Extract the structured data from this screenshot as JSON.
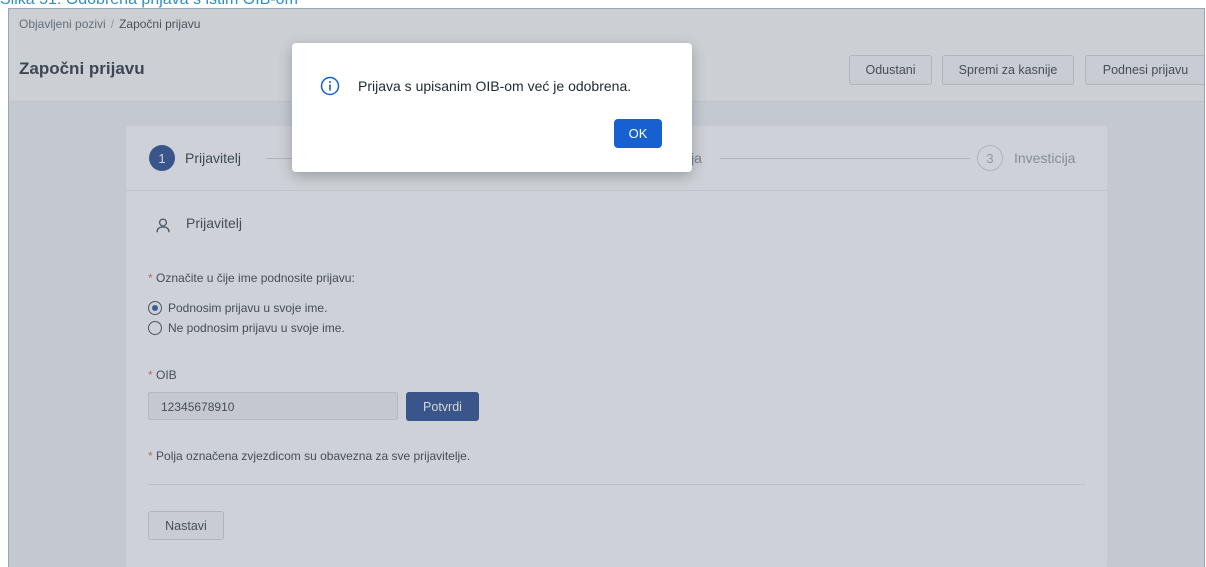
{
  "caption": "Slika 51: Odobrena prijava s istim OIB-om",
  "breadcrumb": {
    "item1": "Objavljeni pozivi",
    "separator": "/",
    "item2": "Započni prijavu"
  },
  "page_title": "Započni prijavu",
  "header_buttons": {
    "cancel": "Odustani",
    "save_later": "Spremi za kasnije",
    "submit": "Podnesi prijavu"
  },
  "stepper": {
    "step1": {
      "number": "1",
      "label": "Prijavitelj"
    },
    "step2": {
      "label_visible_fragment": "ja"
    },
    "step3": {
      "number": "3",
      "label": "Investicija"
    }
  },
  "section": {
    "title": "Prijavitelj",
    "icon": "user-icon"
  },
  "form": {
    "question": "Označite u čije ime podnosite prijavu:",
    "options": [
      "Podnosim prijavu u svoje ime.",
      "Ne podnosim prijavu u svoje ime."
    ],
    "oib_label": "OIB",
    "oib_value": "12345678910",
    "confirm_button": "Potvrdi",
    "required_note": "Polja označena zvjezdicom su obavezna za sve prijavitelje.",
    "required_mark": "*",
    "next_button": "Nastavi"
  },
  "dialog": {
    "icon": "info-icon",
    "message": "Prijava s upisanim OIB-om već je odobrena.",
    "ok_button": "OK"
  },
  "colors": {
    "primary": "#1b3f86",
    "dialog_ok": "#1660d1",
    "required": "#e05a5a",
    "caption": "#2f8fc4"
  }
}
